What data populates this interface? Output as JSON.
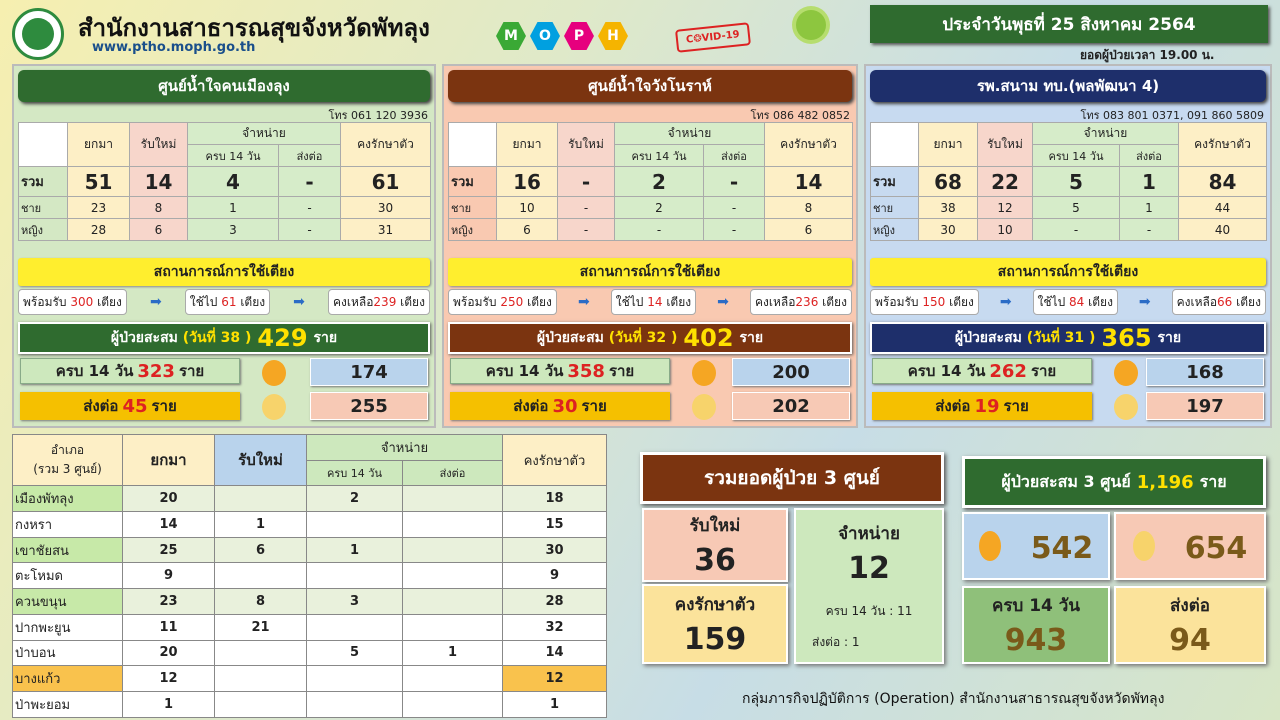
{
  "header": {
    "office": "สำนักงานสาธารณสุขจังหวัดพัทลุง",
    "website": "www.ptho.moph.go.th",
    "moph_letters": [
      "M",
      "O",
      "P",
      "H"
    ],
    "covid_stamp": "C❂VID-19",
    "date": "ประจำวันพุธที่ 25 สิงหาคม 2564",
    "time_note": "ยอดผู้ป่วยเวลา 19.00 น."
  },
  "colors": {
    "green": "#2f6b2f",
    "brown": "#7b3410",
    "navy": "#1e2f6b",
    "yellow": "#ffee2e"
  },
  "cols": {
    "brought": "ยกมา",
    "new": "รับใหม่",
    "discharge": "จำหน่าย",
    "complete14": "ครบ 14 วัน",
    "transfer": "ส่งต่อ",
    "remaining": "คงรักษาตัว",
    "total": "รวม",
    "male": "ชาย",
    "female": "หญิง"
  },
  "bed_title": "สถานการณ์การใช้เตียง",
  "cum_label": "ผู้ป่วยสะสม",
  "unit": "ราย",
  "bed_unit": "เตียง",
  "ready_label": "พร้อมรับ",
  "used_label": "ใช้ไป",
  "left_label": "คงเหลือ",
  "centers": [
    {
      "title": "ศูนย์น้ำใจคนเมืองลุง",
      "phone": "โทร 061 120 3936",
      "total": [
        "51",
        "14",
        "4",
        "-",
        "61"
      ],
      "male": [
        "23",
        "8",
        "1",
        "-",
        "30"
      ],
      "female": [
        "28",
        "6",
        "3",
        "-",
        "31"
      ],
      "bed_ready": "300",
      "bed_used": "61",
      "bed_left": "239",
      "day": "(วันที่ 38 )",
      "cum": "429",
      "c14": "323",
      "send": "45",
      "boy": "174",
      "girl": "255"
    },
    {
      "title": "ศูนย์น้ำใจวังโนราห์",
      "phone": "โทร 086 482 0852",
      "total": [
        "16",
        "-",
        "2",
        "-",
        "14"
      ],
      "male": [
        "10",
        "-",
        "2",
        "-",
        "8"
      ],
      "female": [
        "6",
        "-",
        "-",
        "-",
        "6"
      ],
      "bed_ready": "250",
      "bed_used": "14",
      "bed_left": "236",
      "day": "(วันที่ 32 )",
      "cum": "402",
      "c14": "358",
      "send": "30",
      "boy": "200",
      "girl": "202"
    },
    {
      "title": "รพ.สนาม ทบ.(พลพัฒนา 4)",
      "phone": "โทร 083 801 0371, 091 860 5809",
      "total": [
        "68",
        "22",
        "5",
        "1",
        "84"
      ],
      "male": [
        "38",
        "12",
        "5",
        "1",
        "44"
      ],
      "female": [
        "30",
        "10",
        "-",
        "-",
        "40"
      ],
      "bed_ready": "150",
      "bed_used": "84",
      "bed_left": "66",
      "day": "(วันที่ 31 )",
      "cum": "365",
      "c14": "262",
      "send": "19",
      "boy": "168",
      "girl": "197"
    }
  ],
  "district": {
    "h1": "อำเภอ",
    "h2": "(รวม 3 ศูนย์)",
    "rows": [
      [
        "เมืองพัทลุง",
        "20",
        "",
        "2",
        "",
        "18"
      ],
      [
        "กงหรา",
        "14",
        "1",
        "",
        "",
        "15"
      ],
      [
        "เขาชัยสน",
        "25",
        "6",
        "1",
        "",
        "30"
      ],
      [
        "ตะโหมด",
        "9",
        "",
        "",
        "",
        "9"
      ],
      [
        "ควนขนุน",
        "23",
        "8",
        "3",
        "",
        "28"
      ],
      [
        "ปากพะยูน",
        "11",
        "21",
        "",
        "",
        "32"
      ],
      [
        "ป่าบอน",
        "20",
        "",
        "5",
        "1",
        "14"
      ],
      [
        "บางแก้ว",
        "12",
        "",
        "",
        "",
        "12"
      ],
      [
        "ป่าพะยอม",
        "1",
        "",
        "",
        "",
        "1"
      ]
    ]
  },
  "totals": {
    "title": "รวมยอดผู้ป่วย 3 ศูนย์",
    "new_label": "รับใหม่",
    "new": "36",
    "dis_label": "จำหน่าย",
    "dis": "12",
    "dis_c14": "ครบ 14 วัน   : 11",
    "dis_send": "ส่งต่อ : 1",
    "remain_label": "คงรักษาตัว",
    "remain": "159"
  },
  "cum3": {
    "label": "ผู้ป่วยสะสม 3 ศูนย์",
    "value": "1,196",
    "unit": "ราย",
    "boys": "542",
    "girls": "654",
    "c14_label": "ครบ 14 วัน",
    "c14": "943",
    "send_label": "ส่งต่อ",
    "send": "94"
  },
  "footer": "กลุ่มภารกิจปฏิบัติการ (Operation) สำนักงานสาธารณสุขจังหวัดพัทลุง"
}
